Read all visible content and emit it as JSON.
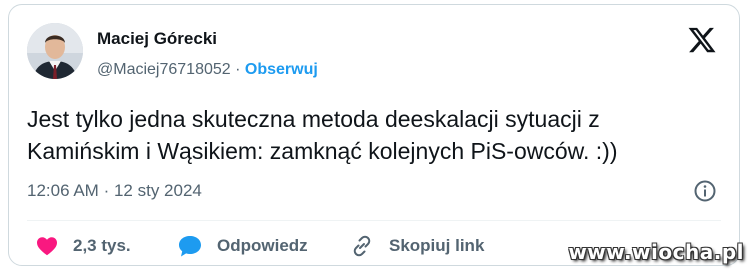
{
  "author": {
    "name": "Maciej Górecki",
    "handle": "@Maciej76718052",
    "separator": "·",
    "follow_label": "Obserwuj"
  },
  "tweet": {
    "text_line1": "Jest tylko jedna skuteczna metoda deeskalacji sytuacji z",
    "text_line2": "Kamińskim i Wąsikiem: zamknąć kolejnych PiS-owców. :))",
    "time": "12:06 AM",
    "date": "12 sty 2024"
  },
  "actions": {
    "likes": "2,3 tys.",
    "reply": "Odpowiedz",
    "copy_link": "Skopiuj link"
  },
  "icons": {
    "logo": "x-logo-icon",
    "like": "heart-icon",
    "reply": "speech-bubble-icon",
    "link": "link-icon",
    "info": "info-icon"
  },
  "colors": {
    "accent": "#1d9bf0",
    "like": "#f91880",
    "text": "#0f1419",
    "muted": "#536471"
  },
  "watermark": "www.wiocha.pl"
}
